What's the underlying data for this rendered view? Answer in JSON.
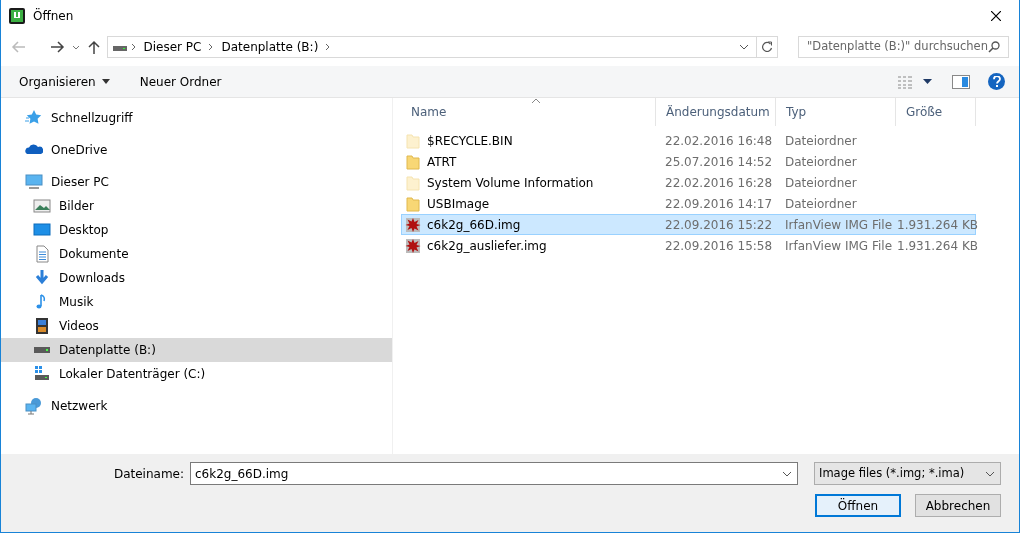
{
  "window": {
    "title": "Öffnen"
  },
  "address": {
    "crumbs": [
      "Dieser PC",
      "Datenplatte (B:)"
    ],
    "search_placeholder": "\"Datenplatte (B:)\" durchsuchen"
  },
  "toolbar": {
    "organize": "Organisieren",
    "new_folder": "Neuer Ordner"
  },
  "sidebar": {
    "items": [
      {
        "label": "Schnellzugriff",
        "selected": false
      },
      {
        "label": "OneDrive",
        "selected": false
      },
      {
        "label": "Dieser PC",
        "selected": false,
        "children": [
          {
            "label": "Bilder",
            "selected": false
          },
          {
            "label": "Desktop",
            "selected": false
          },
          {
            "label": "Dokumente",
            "selected": false
          },
          {
            "label": "Downloads",
            "selected": false
          },
          {
            "label": "Musik",
            "selected": false
          },
          {
            "label": "Videos",
            "selected": false
          },
          {
            "label": "Datenplatte (B:)",
            "selected": true
          },
          {
            "label": "Lokaler Datenträger (C:)",
            "selected": false
          }
        ]
      },
      {
        "label": "Netzwerk",
        "selected": false
      }
    ]
  },
  "table": {
    "columns": [
      "Name",
      "Änderungsdatum",
      "Typ",
      "Größe"
    ],
    "rows": [
      {
        "kind": "folder",
        "hidden": true,
        "selected": false,
        "name": "$RECYCLE.BIN",
        "date": "22.02.2016 16:48",
        "type": "Dateiordner"
      },
      {
        "kind": "folder",
        "hidden": false,
        "selected": false,
        "name": "ATRT",
        "date": "25.07.2016 14:52",
        "type": "Dateiordner"
      },
      {
        "kind": "folder",
        "hidden": true,
        "selected": false,
        "name": "System Volume Information",
        "date": "22.02.2016 16:28",
        "type": "Dateiordner"
      },
      {
        "kind": "folder",
        "hidden": false,
        "selected": false,
        "name": "USBImage",
        "date": "22.09.2016 14:17",
        "type": "Dateiordner"
      },
      {
        "kind": "image",
        "selected": true,
        "name": "c6k2g_66D.img",
        "date": "22.09.2016 15:22",
        "type": "IrfanView IMG File",
        "size": "1.931.264 KB"
      },
      {
        "kind": "image",
        "selected": false,
        "name": "c6k2g_ausliefer.img",
        "date": "22.09.2016 15:58",
        "type": "IrfanView IMG File",
        "size": "1.931.264 KB"
      }
    ]
  },
  "footer": {
    "filename_label": "Dateiname:",
    "filename": "c6k2g_66D.img",
    "filter": "Image files (*.img; *.ima)",
    "open": "Öffnen",
    "cancel": "Abbrechen"
  }
}
